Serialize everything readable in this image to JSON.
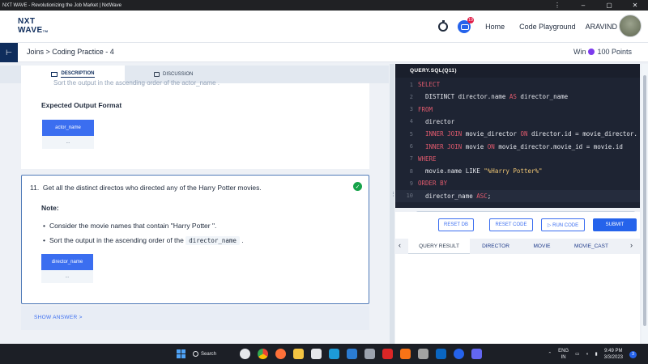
{
  "window": {
    "title": "NXT WAVE - Revolutionizing the Job Market | NxtWave"
  },
  "header": {
    "logo_line1": "NXT",
    "logo_line2": "WAVE",
    "logo_tm": "TM",
    "notification_count": "19",
    "nav_home": "Home",
    "nav_playground": "Code Playground",
    "user_name": "ARAVIND"
  },
  "breadcrumb": {
    "text": "Joins > Coding Practice - 4",
    "win_prefix": "Win",
    "win_points": "100 Points"
  },
  "tabs": {
    "description": "DESCRIPTION",
    "discussion": "DISCUSSION"
  },
  "question10": {
    "cut_line": "Sort the output in the ascending order of the  actor_name  .",
    "expected_heading": "Expected Output Format",
    "table_header": "actor_name",
    "table_cell": "..."
  },
  "question11": {
    "number": "11.",
    "text": "Get all the distinct directos who directed any of the Harry Potter movies.",
    "note_label": "Note:",
    "bullet1": "Consider the movie names that contain \"Harry Potter \".",
    "bullet2_prefix": "Sort the output in the ascending order of the",
    "bullet2_code": "director_name",
    "bullet2_suffix": ".",
    "table_header": "director_name",
    "table_cell": "..."
  },
  "show_answer": "SHOW ANSWER >",
  "editor": {
    "tab_label": "QUERY.SQL(Q11)",
    "lines": [
      {
        "n": "1",
        "parts": [
          [
            "kw",
            "SELECT"
          ]
        ]
      },
      {
        "n": "2",
        "parts": [
          [
            "tx",
            "  DISTINCT director.name "
          ],
          [
            "kw",
            "AS"
          ],
          [
            "tx",
            " director_name"
          ]
        ]
      },
      {
        "n": "3",
        "parts": [
          [
            "kw",
            "FROM"
          ]
        ]
      },
      {
        "n": "4",
        "parts": [
          [
            "tx",
            "  director"
          ]
        ]
      },
      {
        "n": "5",
        "parts": [
          [
            "kw",
            "  INNER JOIN"
          ],
          [
            "tx",
            " movie_director "
          ],
          [
            "kw",
            "ON"
          ],
          [
            "tx",
            " director.id = movie_director."
          ]
        ]
      },
      {
        "n": "6",
        "parts": [
          [
            "kw",
            "  INNER JOIN"
          ],
          [
            "tx",
            " movie "
          ],
          [
            "kw",
            "ON"
          ],
          [
            "tx",
            " movie_director.movie_id = movie.id"
          ]
        ]
      },
      {
        "n": "7",
        "parts": [
          [
            "kw",
            "WHERE"
          ]
        ]
      },
      {
        "n": "8",
        "parts": [
          [
            "tx",
            "  movie.name LIKE "
          ],
          [
            "st",
            "\"%Harry Potter%\""
          ]
        ]
      },
      {
        "n": "9",
        "parts": [
          [
            "kw",
            "ORDER BY"
          ]
        ]
      },
      {
        "n": "10",
        "parts": [
          [
            "tx",
            "  director_name "
          ],
          [
            "kw",
            "ASC"
          ],
          [
            "tx",
            ";"
          ]
        ]
      }
    ]
  },
  "actions": {
    "reset_db": "RESET DB",
    "reset_code": "RESET CODE",
    "run_code": "▷ RUN CODE",
    "submit": "SUBMIT"
  },
  "result_tabs": [
    "QUERY RESULT",
    "DIRECTOR",
    "MOVIE",
    "MOVIE_CAST"
  ],
  "taskbar": {
    "search": "Search",
    "lang_top": "ENG",
    "lang_bottom": "IN",
    "time": "9:49 PM",
    "date": "3/3/2023",
    "notif": "3"
  }
}
